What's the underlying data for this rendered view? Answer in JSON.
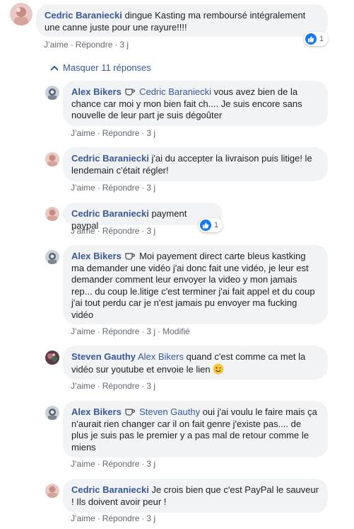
{
  "actions": {
    "like": "J’aime",
    "reply": "Répondre",
    "sep": "·"
  },
  "hide_replies": "Masquer 11 réponses",
  "colors": {
    "link": "#385898",
    "bubble": "#f2f3f5",
    "meta": "#606770",
    "like_blue": "#1877f2"
  },
  "top_comment": {
    "author": "Cedric Baraniecki",
    "text": "dingue Kasting ma remboursé intégralement une canne juste pour une rayure!!!!",
    "time": "3 j",
    "reaction": {
      "icon": "like-icon",
      "count": "1"
    }
  },
  "replies": [
    {
      "author": "Alex Bikers",
      "badge": "cup-icon",
      "mention": "Cedric Baraniecki",
      "text": "vous avez bien de la chance car moi y mon bien fait ch.... Je suis encore sans nouvelle de leur part je suis dégoûter",
      "time": "3 j"
    },
    {
      "author": "Cedric Baraniecki",
      "text": "j'ai du accepter la livraison puis litige! le lendemain c'était régler!",
      "time": "3 j"
    },
    {
      "author": "Cedric Baraniecki",
      "text": "payment paypal",
      "time": "3 j",
      "reaction": {
        "icon": "like-icon",
        "count": "1"
      }
    },
    {
      "author": "Alex Bikers",
      "badge": "cup-icon",
      "text": "Moi payement direct carte bleus kastking ma demander une vidéo j'ai donc fait une vidéo, je leur est demander comment leur envoyer la video y mon jamais rep... du coup le.litige c'est terminer j'ai fait appel et du coup j'ai tout perdu car je n'est jamais pu envoyer ma fucking vidéo",
      "time": "3 j",
      "edited": "Modifié"
    },
    {
      "author": "Steven Gauthy",
      "mention": "Alex Bikers",
      "text": "quand c'est comme ca met la vidéo sur youtube et envoie le lien",
      "emoji": "wink-emoji",
      "time": "3 j"
    },
    {
      "author": "Alex Bikers",
      "badge": "cup-icon",
      "mention": "Steven Gauthy",
      "text": "oui j'ai voulu le faire mais ça n'aurait rien changer car il on fait genre j'existe pas.... de plus je suis pas le premier y a pas mal de retour comme le miens",
      "time": "3 j"
    },
    {
      "author": "Cedric Baraniecki",
      "text": "Je crois bien que c'est PayPal le sauveur ! Ils doivent avoir peur !",
      "time": "3 j"
    }
  ]
}
